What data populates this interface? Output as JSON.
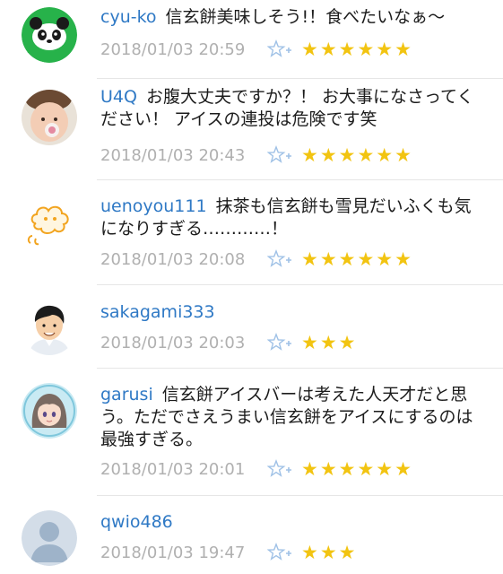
{
  "comments": [
    {
      "username": "cyu-ko",
      "text": "信玄餅美味しそう!！食べたいなぁ～",
      "timestamp": "2018/01/03 20:59",
      "stars": "★★★★★★",
      "avatar": "panda-avatar"
    },
    {
      "username": "U4Q",
      "text": "お腹大丈夫ですか？！ お大事になさってください！ アイスの連投は危険です笑",
      "timestamp": "2018/01/03 20:43",
      "stars": "★★★★★★",
      "avatar": "child-avatar"
    },
    {
      "username": "uenoyou111",
      "text": "抹茶も信玄餅も雪見だいふくも気になりすぎる…………！",
      "timestamp": "2018/01/03 20:08",
      "stars": "★★★★★★",
      "avatar": "cloud-character-avatar"
    },
    {
      "username": "sakagami333",
      "text": "",
      "timestamp": "2018/01/03 20:03",
      "stars": "★★★",
      "avatar": "man-illustration-avatar"
    },
    {
      "username": "garusi",
      "text": "信玄餅アイスバーは考えた人天才だと思う。ただでさえうまい信玄餅をアイスにするのは最強すぎる。",
      "timestamp": "2018/01/03 20:01",
      "stars": "★★★★★★",
      "avatar": "anime-girl-avatar"
    },
    {
      "username": "qwio486",
      "text": "",
      "timestamp": "2018/01/03 19:47",
      "stars": "★★★",
      "avatar": "default-user-avatar"
    }
  ],
  "colors": {
    "username": "#2f79c5",
    "timestamp": "#b0b0b0",
    "star": "#f2c411",
    "fav_icon": "#9fc1e6",
    "divider": "#e6e6e6"
  }
}
